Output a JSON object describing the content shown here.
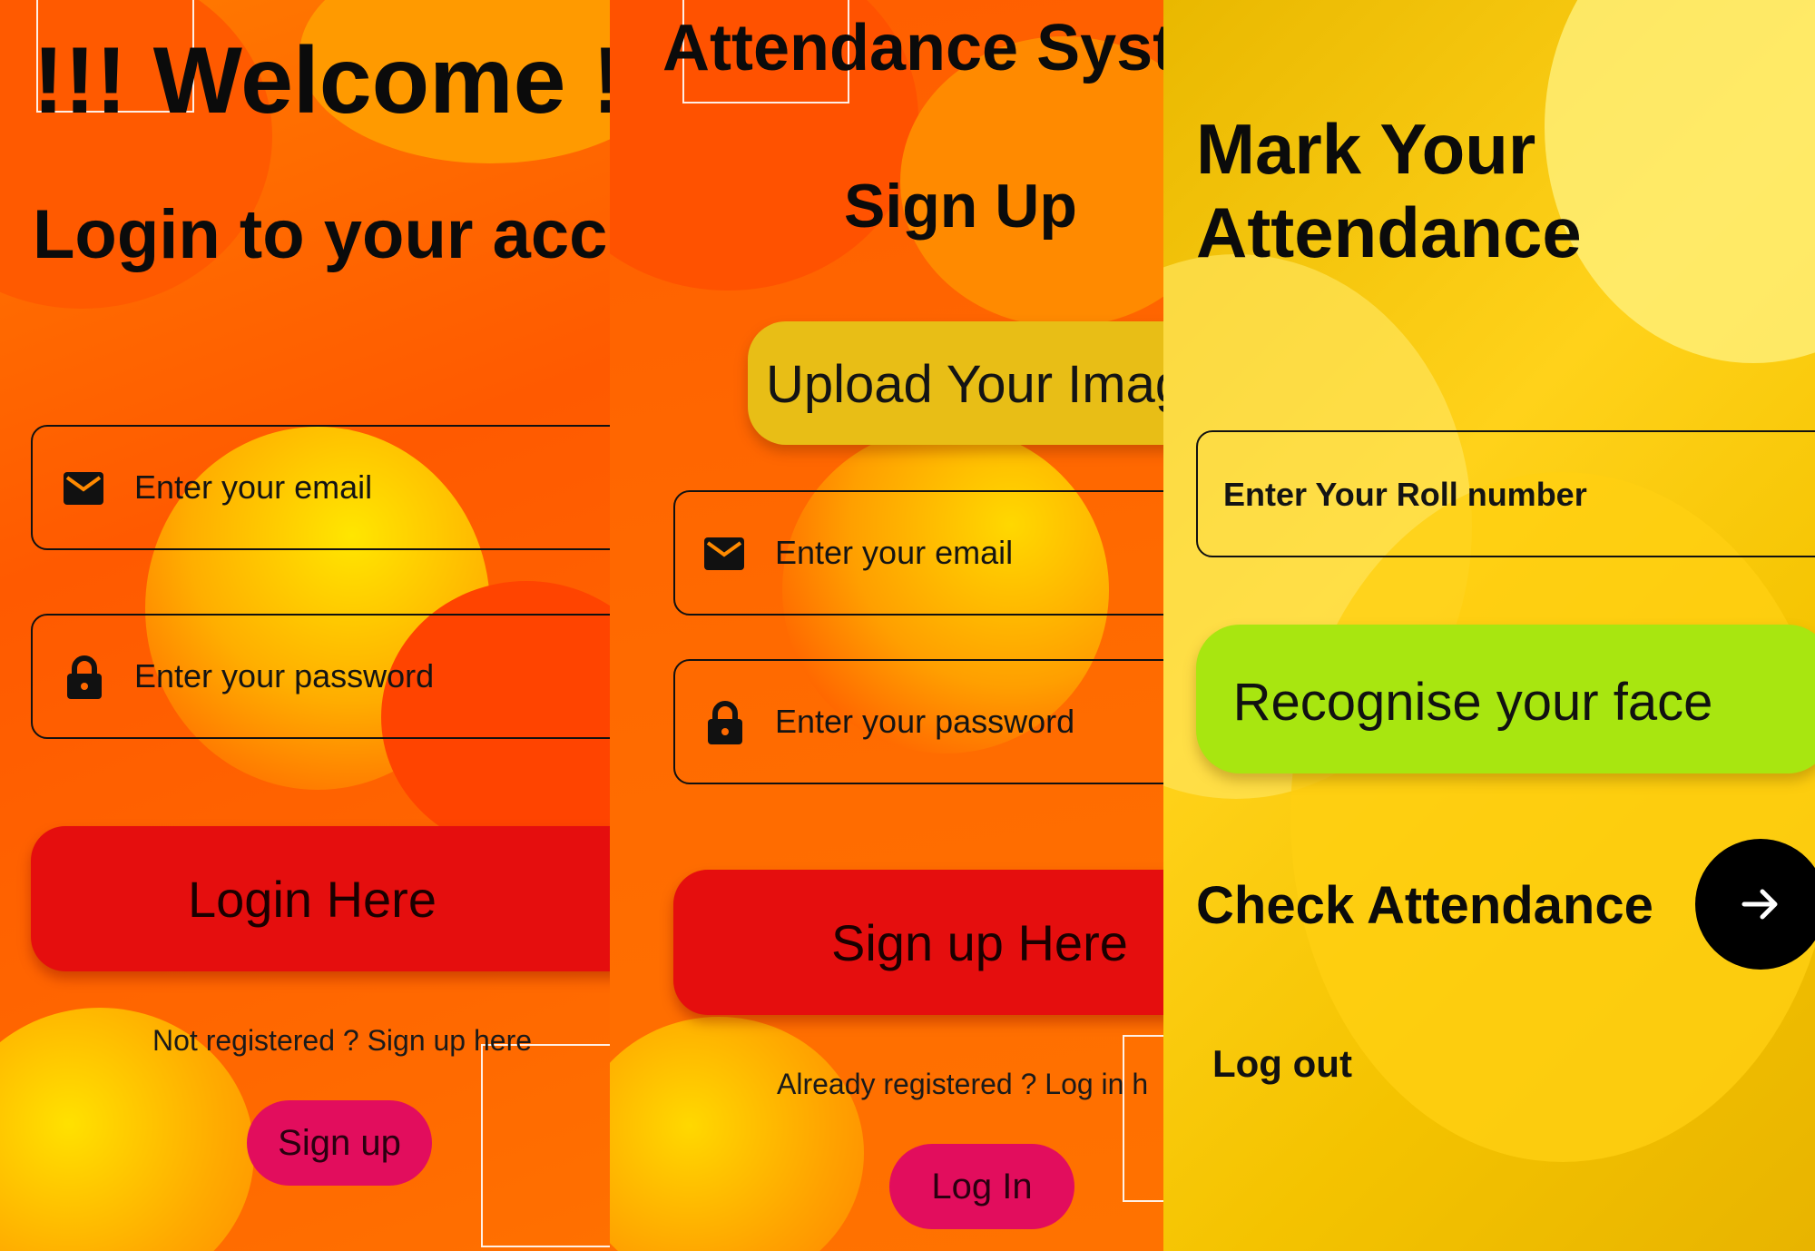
{
  "login": {
    "welcome": "!!! Welcome !!",
    "subtitle": "Login to your acco",
    "email_placeholder": "Enter your email",
    "password_placeholder": "Enter your password",
    "login_button": "Login Here",
    "not_registered": "Not registered ? Sign up here",
    "signup_button": "Sign up"
  },
  "signup": {
    "title": "Attendance Syst",
    "heading": "Sign Up",
    "upload_button": "Upload Your Imag",
    "email_placeholder": "Enter your email",
    "password_placeholder": "Enter your password",
    "signup_button": "Sign up Here",
    "already_registered": "Already registered ? Log in h",
    "login_button": "Log In"
  },
  "attendance": {
    "title_line1": "Mark Your",
    "title_line2": "Attendance",
    "roll_placeholder": "Enter Your Roll number",
    "recognise_button": "Recognise your face",
    "check_label": "Check Attendance",
    "logout": "Log out"
  },
  "colors": {
    "red_button": "#e50e0e",
    "pink_pill": "#e20d5d",
    "green_button": "#a8e610",
    "upload_button": "#e8be16"
  }
}
